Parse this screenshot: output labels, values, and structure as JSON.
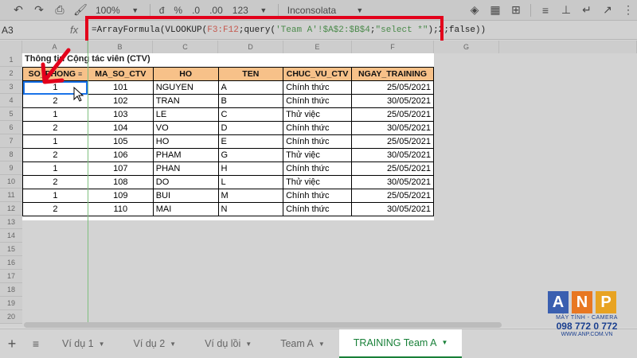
{
  "toolbar": {
    "zoom": "100%",
    "currency": "đ",
    "percent": "%",
    "dec_less": ".0",
    "dec_more": ".00",
    "format_more": "123",
    "font": "Inconsolata"
  },
  "formula_bar": {
    "name_box": "A3",
    "fx": "fx",
    "formula_prefix": "=ArrayFormula(VLOOKUP(",
    "formula_range": "F3:F12",
    "formula_mid": ";query(",
    "formula_sheet": "'Team A'!$A$2:$B$4",
    "formula_semicolon": ";",
    "formula_query": "\"select *\"",
    "formula_suffix": ");2;false))"
  },
  "columns": [
    "A",
    "B",
    "C",
    "D",
    "E",
    "F",
    "G"
  ],
  "rows": [
    "1",
    "2",
    "3",
    "4",
    "5",
    "6",
    "7",
    "8",
    "9",
    "10",
    "11",
    "12",
    "13",
    "14",
    "15",
    "16",
    "17",
    "18",
    "19",
    "20"
  ],
  "sheet": {
    "title": "Thông tin Cộng tác viên (CTV)",
    "headers": [
      "SO_PHONG",
      "MA_SO_CTV",
      "HO",
      "TEN",
      "CHUC_VU_CTV",
      "NGAY_TRAINING"
    ],
    "rows": [
      [
        "1",
        "101",
        "NGUYEN",
        "A",
        "Chính thức",
        "25/05/2021"
      ],
      [
        "2",
        "102",
        "TRAN",
        "B",
        "Chính thức",
        "30/05/2021"
      ],
      [
        "1",
        "103",
        "LE",
        "C",
        "Thử việc",
        "25/05/2021"
      ],
      [
        "2",
        "104",
        "VO",
        "D",
        "Chính thức",
        "30/05/2021"
      ],
      [
        "1",
        "105",
        "HO",
        "E",
        "Chính thức",
        "25/05/2021"
      ],
      [
        "2",
        "106",
        "PHAM",
        "G",
        "Thử việc",
        "30/05/2021"
      ],
      [
        "1",
        "107",
        "PHAN",
        "H",
        "Chính thức",
        "25/05/2021"
      ],
      [
        "2",
        "108",
        "DO",
        "L",
        "Thử việc",
        "30/05/2021"
      ],
      [
        "1",
        "109",
        "BUI",
        "M",
        "Chính thức",
        "25/05/2021"
      ],
      [
        "2",
        "110",
        "MAI",
        "N",
        "Chính thức",
        "30/05/2021"
      ]
    ]
  },
  "tabs": [
    {
      "label": "Ví dụ 1"
    },
    {
      "label": "Ví dụ 2"
    },
    {
      "label": "Ví dụ lồi"
    },
    {
      "label": "Team A"
    },
    {
      "label": "TRAINING Team A"
    }
  ],
  "logo": {
    "letters": [
      "A",
      "N",
      "P"
    ],
    "subtitle": "MÁY TÍNH - CAMERA",
    "phone": "098 772 0 772",
    "web": "WWW.ANP.COM.VN",
    "colors": [
      "#3a5fb0",
      "#e87722",
      "#e8a322"
    ]
  },
  "colors": {
    "header_fill": "#f7c189",
    "highlight": "#e3001b",
    "active_tab": "#188038"
  }
}
